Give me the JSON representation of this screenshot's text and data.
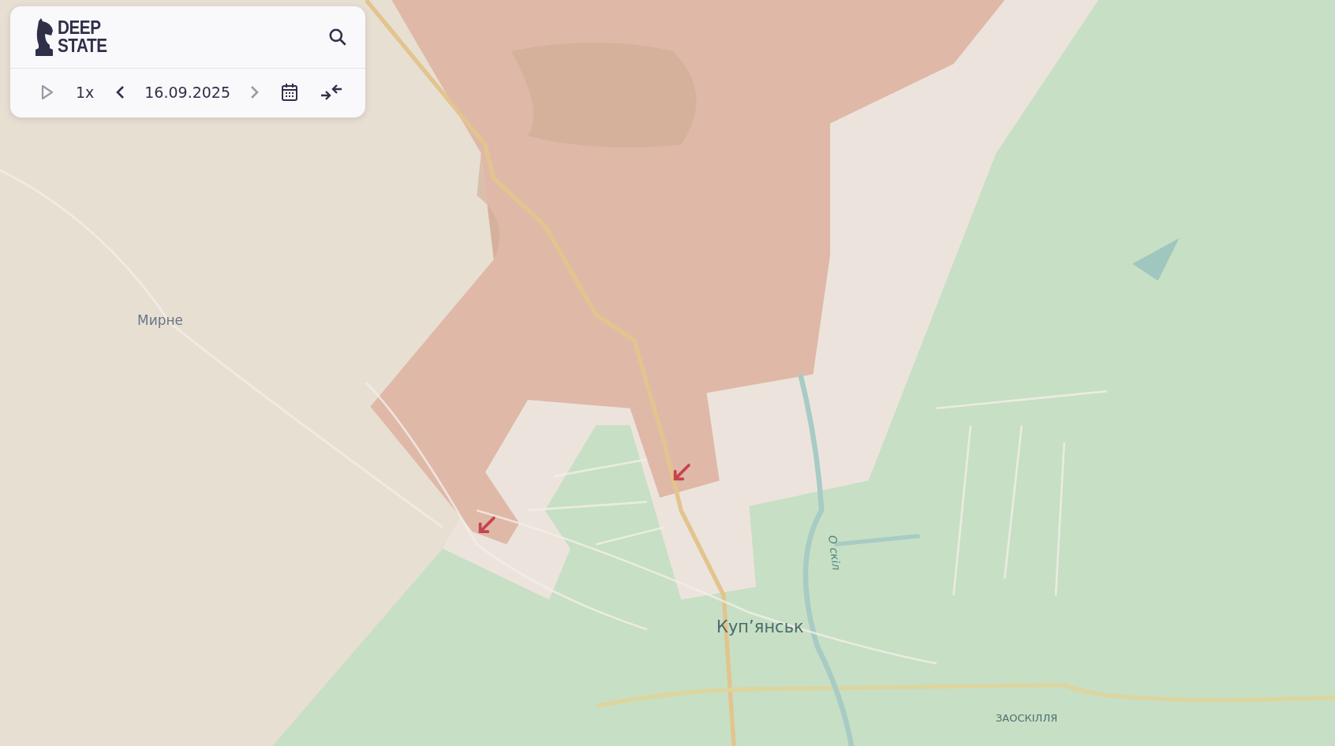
{
  "logo": {
    "lines": [
      "DEEP",
      "STATE"
    ]
  },
  "player": {
    "play_disabled": true,
    "speed": "1x",
    "prev_disabled": false,
    "date": "16.09.2025",
    "next_disabled": true
  },
  "map_labels": [
    {
      "kind": "town",
      "text": "Мирне"
    },
    {
      "kind": "city",
      "text": "Куп’янськ"
    },
    {
      "kind": "river",
      "text": "О скіл"
    },
    {
      "kind": "district",
      "text": "ЗАОСКІЛЛЯ"
    }
  ]
}
